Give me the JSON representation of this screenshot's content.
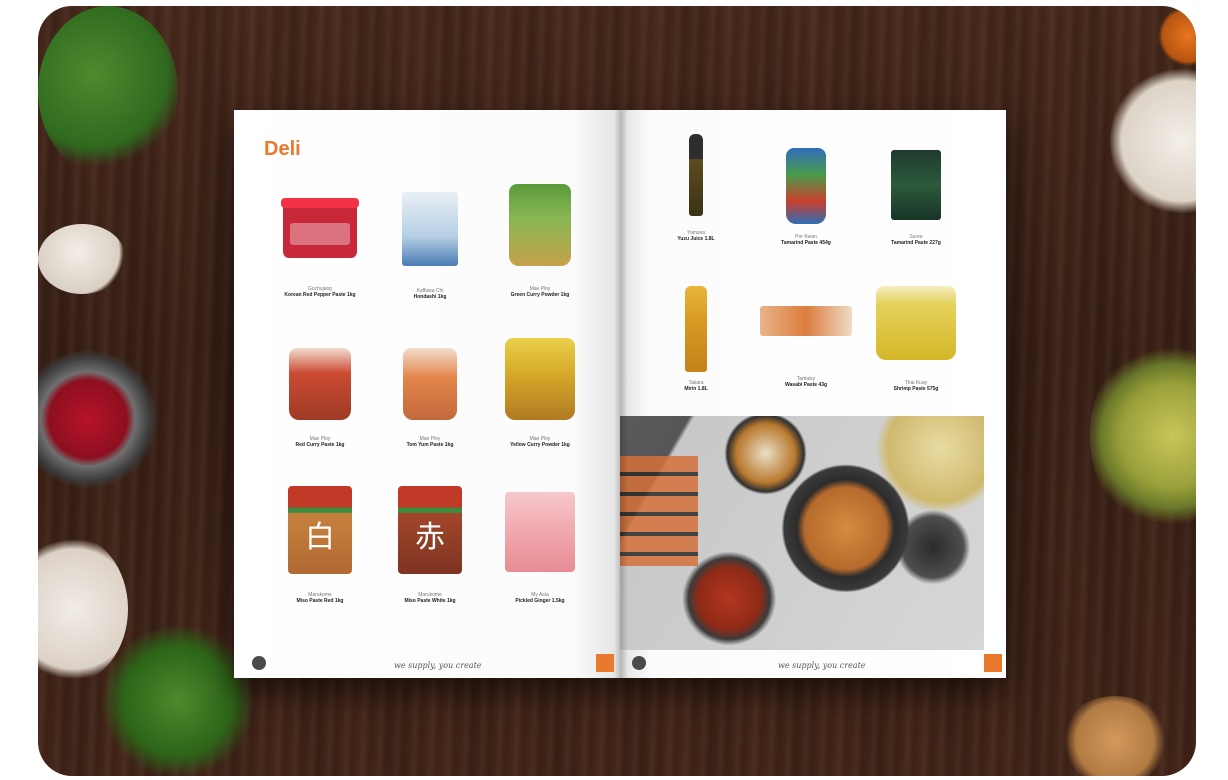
{
  "left_page": {
    "title": "Deli",
    "products": [
      {
        "brand": "Gochujang",
        "name": "Korean Red Pepper Paste 1kg"
      },
      {
        "brand": "Kaffuwa Chi",
        "name": "Hondashi 1kg"
      },
      {
        "brand": "Mae Ploy",
        "name": "Green Curry Powder 1kg"
      },
      {
        "brand": "Mae Ploy",
        "name": "Red Curry Paste 1kg"
      },
      {
        "brand": "Mae Ploy",
        "name": "Tom Yum Paste 1kg"
      },
      {
        "brand": "Mae Ploy",
        "name": "Yellow Curry Powder 1kg"
      },
      {
        "brand": "Marukome",
        "name": "Miso Paste Red 1kg"
      },
      {
        "brand": "Marukome",
        "name": "Miso Paste White 1kg"
      },
      {
        "brand": "My Asia",
        "name": "Pickled Ginger 1.5kg"
      }
    ],
    "kanji": [
      "白",
      "赤"
    ],
    "footer_script": "we supply, you create"
  },
  "right_page": {
    "products": [
      {
        "brand": "Yamasa",
        "name": "Yuzu Juice 1.8L"
      },
      {
        "brand": "Por Kwan",
        "name": "Tamarind Paste 454g"
      },
      {
        "brand": "Suree",
        "name": "Tamarind Paste 227g"
      },
      {
        "brand": "Takara",
        "name": "Mirin 1.8L"
      },
      {
        "brand": "Tamaisy",
        "name": "Wasabi Paste 43g"
      },
      {
        "brand": "Thai Kuay",
        "name": "Shrimp Paste 575g"
      }
    ],
    "footer_script": "we supply, you create"
  },
  "colors": {
    "accent": "#e8792d",
    "wood": "#3c2116"
  }
}
